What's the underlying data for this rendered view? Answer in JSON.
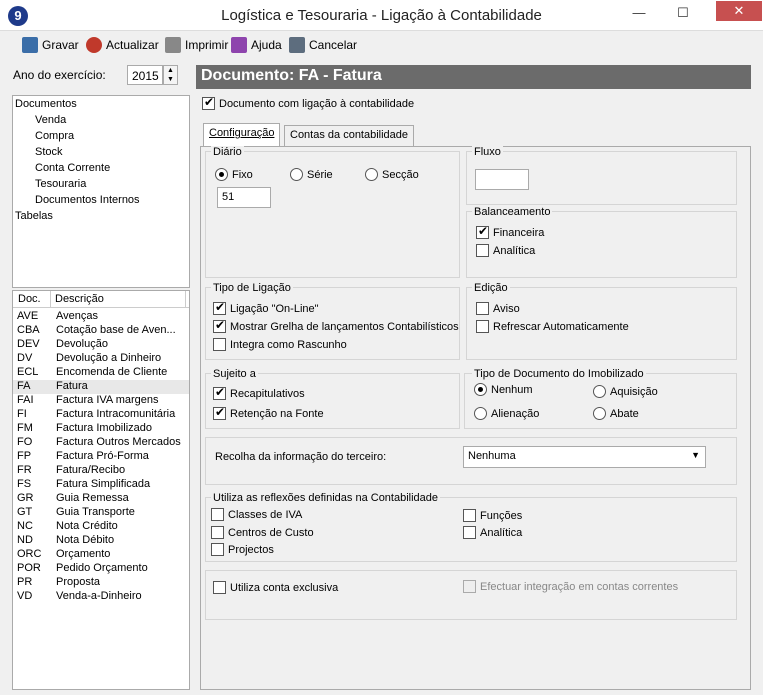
{
  "window": {
    "title": "Logística e Tesouraria - Ligação à Contabilidade",
    "app_icon": "9"
  },
  "toolbar": {
    "save": "Gravar",
    "refresh": "Actualizar",
    "print": "Imprimir",
    "help": "Ajuda",
    "cancel": "Cancelar"
  },
  "year": {
    "label": "Ano do exercício:",
    "value": "2015"
  },
  "tree": {
    "root": "Documentos",
    "children": [
      "Venda",
      "Compra",
      "Stock",
      "Conta Corrente",
      "Tesouraria",
      "Documentos Internos"
    ],
    "other": "Tabelas"
  },
  "doclist": {
    "headers": [
      "Doc.",
      "Descrição"
    ],
    "rows": [
      {
        "code": "AVE",
        "desc": "Avenças"
      },
      {
        "code": "CBA",
        "desc": "Cotação base de Aven..."
      },
      {
        "code": "DEV",
        "desc": "Devolução"
      },
      {
        "code": "DV",
        "desc": "Devolução a Dinheiro"
      },
      {
        "code": "ECL",
        "desc": "Encomenda de Cliente"
      },
      {
        "code": "FA",
        "desc": "Fatura"
      },
      {
        "code": "FAI",
        "desc": "Factura IVA margens"
      },
      {
        "code": "FI",
        "desc": "Factura Intracomunitária"
      },
      {
        "code": "FM",
        "desc": "Factura Imobilizado"
      },
      {
        "code": "FO",
        "desc": "Factura Outros Mercados"
      },
      {
        "code": "FP",
        "desc": "Factura Pró-Forma"
      },
      {
        "code": "FR",
        "desc": "Fatura/Recibo"
      },
      {
        "code": "FS",
        "desc": "Fatura Simplificada"
      },
      {
        "code": "GR",
        "desc": "Guia Remessa"
      },
      {
        "code": "GT",
        "desc": "Guia Transporte"
      },
      {
        "code": "NC",
        "desc": "Nota Crédito"
      },
      {
        "code": "ND",
        "desc": "Nota Débito"
      },
      {
        "code": "ORC",
        "desc": "Orçamento"
      },
      {
        "code": "POR",
        "desc": "Pedido Orçamento"
      },
      {
        "code": "PR",
        "desc": "Proposta"
      },
      {
        "code": "VD",
        "desc": "Venda-a-Dinheiro"
      }
    ],
    "selected": "FA"
  },
  "document": {
    "header": "Documento: FA - Fatura",
    "linked_label": "Documento com ligação à contabilidade",
    "linked": true
  },
  "tabs": [
    "Configuração",
    "Contas da contabilidade"
  ],
  "diario": {
    "title": "Diário",
    "options": [
      "Fixo",
      "Série",
      "Secção"
    ],
    "selected": "Fixo",
    "value": "51"
  },
  "fluxo": {
    "title": "Fluxo",
    "value": ""
  },
  "balanceamento": {
    "title": "Balanceamento",
    "financeira": "Financeira",
    "financeira_checked": true,
    "analitica": "Analítica",
    "analitica_checked": false
  },
  "tipo_ligacao": {
    "title": "Tipo de Ligação",
    "online": "Ligação \"On-Line\"",
    "online_checked": true,
    "grelha": "Mostrar Grelha de lançamentos Contabilísticos",
    "grelha_checked": true,
    "rascunho": "Integra como Rascunho",
    "rascunho_checked": false
  },
  "edicao": {
    "title": "Edição",
    "aviso": "Aviso",
    "aviso_checked": false,
    "refrescar": "Refrescar Automaticamente",
    "refrescar_checked": false
  },
  "sujeito": {
    "title": "Sujeito a",
    "recap": "Recapitulativos",
    "recap_checked": true,
    "retencao": "Retenção na Fonte",
    "retencao_checked": true
  },
  "imobilizado": {
    "title": "Tipo de Documento do Imobilizado",
    "options": [
      "Nenhum",
      "Aquisição",
      "Alienação",
      "Abate"
    ],
    "selected": "Nenhum"
  },
  "terceiro": {
    "label": "Recolha da informação do terceiro:",
    "value": "Nenhuma"
  },
  "reflexoes": {
    "title": "Utiliza as reflexões definidas na Contabilidade",
    "iva": "Classes de IVA",
    "custo": "Centros de Custo",
    "projectos": "Projectos",
    "funcoes": "Funções",
    "analitica": "Analítica"
  },
  "exclusiva": {
    "label": "Utiliza conta exclusiva",
    "integracao": "Efectuar integração em contas correntes"
  }
}
